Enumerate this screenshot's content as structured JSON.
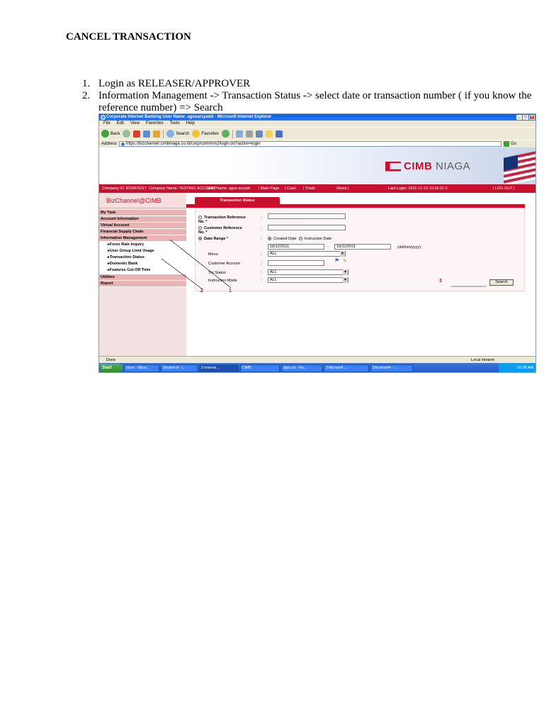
{
  "doc": {
    "title": "CANCEL TRANSACTION",
    "steps": [
      {
        "num": "1.",
        "text": "Login as RELEASER/APPROVER"
      },
      {
        "num": "2.",
        "text": "Information Management -> Transaction Status -> select date or transaction number ( if you know the reference number)  => Search"
      }
    ]
  },
  "browser": {
    "title": "Corporate Internet Banking User Name: agusarsyadd - Microsoft Internet Explorer",
    "menu": [
      "File",
      "Edit",
      "View",
      "Favorites",
      "Tools",
      "Help"
    ],
    "toolbar": {
      "back": "Back",
      "search": "Search",
      "favorites": "Favorites"
    },
    "address_label": "Address",
    "address": "https://bizchannel.cimbniaga.co.id/corp/common2/login.do?action=login",
    "go_label": "Go"
  },
  "app": {
    "logo_main": "CIMB",
    "logo_sub": "NIAGA",
    "infobar": {
      "company_id": "Company ID: IDS95TEST",
      "company_name": "Company Name: TESTING ACCOUNT",
      "user_name": "User Name: agus arsyad",
      "main_page": "| Main Page",
      "cash": "| Cash",
      "trade": "| Trade",
      "about": "About |",
      "last_login": "Last Login: 2011-12-19 10:16:31.0",
      "logout": "| LOG OUT |"
    },
    "sidebar": {
      "brand": "BizChannel@CIMB",
      "items": [
        "My Task",
        "Account Information",
        "Virtual Account",
        "Financial Supply Chain",
        "Information Management"
      ],
      "subitems": [
        "▸Forex Rate Inquiry",
        "▸User Group Limit Usage",
        "▸Transaction Status",
        "▸Domestic Bank",
        "▸Features Cut-Off Time"
      ],
      "items_after": [
        "Utilities",
        "Report"
      ]
    },
    "form": {
      "tab": "Transaction Status",
      "txn_ref_label": "Transaction Reference No. *",
      "cust_ref_label": "Customer Reference No. *",
      "date_range_label": "Date Range *",
      "created_date": "Created Date",
      "instruction_date": "Instruction Date",
      "date_from": "18/12/2011",
      "date_dash": "-",
      "date_to": "19/12/2011",
      "date_format": "(dd/mm/yyyy)",
      "menu_label": "Menu",
      "menu_value": "ALL",
      "customer_account_label": "Customer Account",
      "trx_status_label": "Trx Status",
      "trx_status_value": "ALL",
      "instruction_mode_label": "Instruction Mode",
      "instruction_mode_value": "ALL",
      "colon": ":",
      "search_button": "Search"
    },
    "annotations": {
      "n1": "1",
      "n2": "2",
      "n3": "3"
    }
  },
  "status": {
    "left": "Done",
    "zone": "Local intranet"
  },
  "taskbar": {
    "start": "Start",
    "tasks": [
      "Inbox - Micro...",
      "Session A - [...",
      "5 Internet ...",
      "CIMB",
      "agus.txt - No...",
      "3 Microsoft ...",
      "Document4 - ..."
    ],
    "clock": "10:38 AM"
  }
}
